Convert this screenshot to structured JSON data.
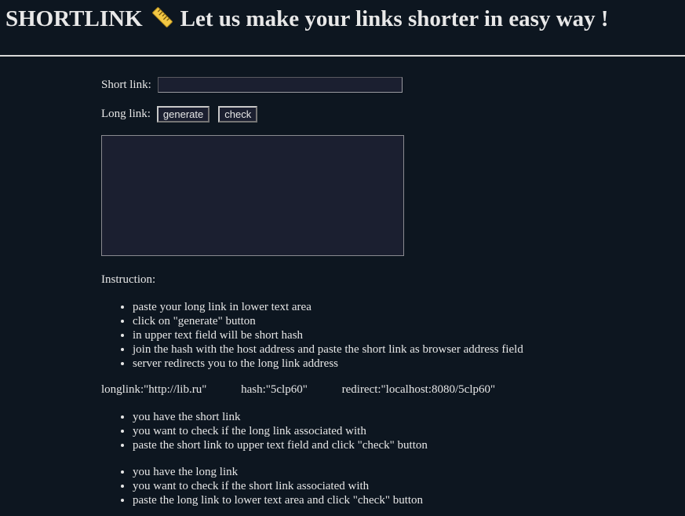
{
  "header": {
    "title_prefix": "SHORTLINK",
    "ruler_icon": "ruler-icon",
    "title_suffix": "Let us make your links shorter in easy way !"
  },
  "form": {
    "short_label": "Short link:",
    "short_value": "",
    "long_label": "Long link:",
    "generate_label": "generate",
    "check_label": "check",
    "long_value": ""
  },
  "instruction": {
    "title": "Instruction:",
    "steps": [
      "paste your long link in lower text area",
      "click on \"generate\" button",
      "in upper text field will be short hash",
      "join the hash with the host address and paste the short link as browser address field",
      "server redirects you to the long link address"
    ],
    "example": {
      "longlink": "longlink:\"http://lib.ru\"",
      "hash": "hash:\"5clp60\"",
      "redirect": "redirect:\"localhost:8080/5clp60\""
    },
    "check_short": [
      "you have the short link",
      "you want to check if the long link associated with",
      "paste the short link to upper text field and click \"check\" button"
    ],
    "check_long": [
      "you have the long link",
      "you want to check if the short link associated with",
      "paste the long link to lower text area and click \"check\" button"
    ]
  },
  "colors": {
    "background": "#0d1620",
    "text": "#e6e6e6",
    "field_background": "#1b1f30"
  }
}
